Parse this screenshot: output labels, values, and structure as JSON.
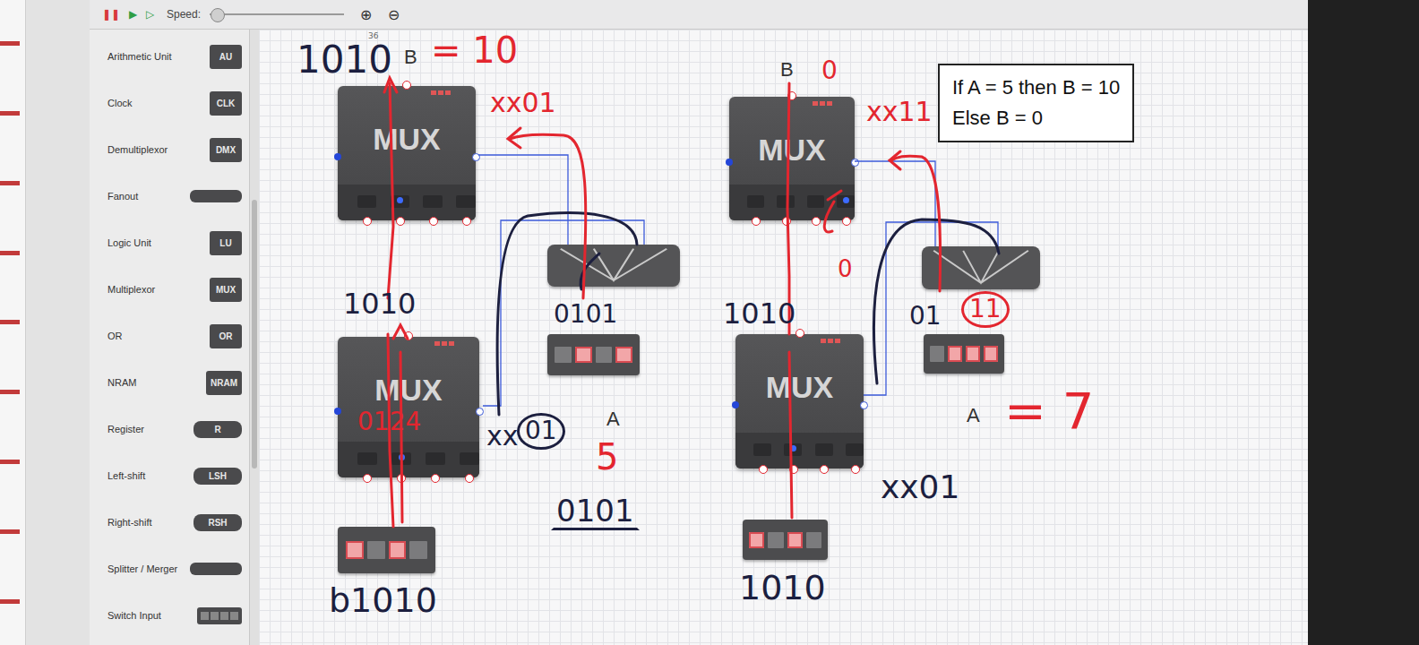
{
  "toolbar": {
    "controls": [
      {
        "glyph": "❚❚",
        "color": "#d83a3a"
      },
      {
        "glyph": "▶",
        "color": "#2f9e44"
      },
      {
        "glyph": "▷",
        "color": "#2f9e44"
      }
    ],
    "speed_label": "Speed:",
    "speed_level": 0.06,
    "zoom": [
      "⊕",
      "⊖"
    ]
  },
  "palette": [
    {
      "label": "Arithmetic Unit",
      "chip": "AU",
      "kind": "chip"
    },
    {
      "label": "Clock",
      "chip": "CLK",
      "kind": "chip"
    },
    {
      "label": "Demultiplexor",
      "chip": "DMX",
      "kind": "chip"
    },
    {
      "label": "Fanout",
      "chip": "",
      "kind": "bar"
    },
    {
      "label": "Logic Unit",
      "chip": "LU",
      "kind": "chip"
    },
    {
      "label": "Multiplexor",
      "chip": "MUX",
      "kind": "chip"
    },
    {
      "label": "OR",
      "chip": "OR",
      "kind": "chip"
    },
    {
      "label": "NRAM",
      "chip": "NRAM",
      "kind": "chip"
    },
    {
      "label": "Register",
      "chip": "R",
      "kind": "wide"
    },
    {
      "label": "Left-shift",
      "chip": "LSH",
      "kind": "wide"
    },
    {
      "label": "Right-shift",
      "chip": "RSH",
      "kind": "wide"
    },
    {
      "label": "Splitter / Merger",
      "chip": "",
      "kind": "bar"
    },
    {
      "label": "Switch Input",
      "chip": "",
      "kind": "switch"
    }
  ],
  "components": [
    {
      "kind": "mux",
      "label": "MUX",
      "selected_input": 1
    },
    {
      "kind": "mux",
      "label": "MUX",
      "selected_input": 1
    },
    {
      "kind": "mux",
      "label": "MUX",
      "selected_input": 3
    },
    {
      "kind": "mux",
      "label": "MUX",
      "selected_input": 1
    },
    {
      "kind": "splitter"
    },
    {
      "kind": "splitter"
    },
    {
      "kind": "switch",
      "bits": [
        true,
        false,
        true,
        false
      ]
    },
    {
      "kind": "switch",
      "bits": [
        false,
        true,
        false,
        true
      ]
    },
    {
      "kind": "switch",
      "bits": [
        true,
        false,
        true,
        false
      ]
    },
    {
      "kind": "switch",
      "bits": [
        false,
        true,
        true,
        true
      ]
    }
  ],
  "labels": [
    "B",
    "B",
    "A",
    "A"
  ],
  "note": [
    "If A = 5 then B = 10",
    "Else B = 0"
  ],
  "annotations": [
    {
      "text": "1010",
      "color": "#1c1f3f",
      "circled": false,
      "underlined": false
    },
    {
      "text": "36",
      "color": "#666666",
      "circled": false,
      "underlined": false
    },
    {
      "text": "= 10",
      "color": "#e3262f",
      "circled": false,
      "underlined": false
    },
    {
      "text": "xx01",
      "color": "#e3262f",
      "circled": false,
      "underlined": false
    },
    {
      "text": "1010",
      "color": "#1c1f3f",
      "circled": false,
      "underlined": false
    },
    {
      "text": "0124",
      "color": "#e3262f",
      "circled": false,
      "underlined": false
    },
    {
      "text": "xx",
      "color": "#1c1f3f",
      "circled": false,
      "underlined": false
    },
    {
      "text": "01",
      "color": "#1c1f3f",
      "circled": true,
      "underlined": false
    },
    {
      "text": "5",
      "color": "#e3262f",
      "circled": false,
      "underlined": false
    },
    {
      "text": "0101",
      "color": "#1c1f3f",
      "circled": false,
      "underlined": true
    },
    {
      "text": "b1010",
      "color": "#1c1f3f",
      "circled": false,
      "underlined": false
    },
    {
      "text": "0101",
      "color": "#1c1f3f",
      "circled": false,
      "underlined": false
    },
    {
      "text": "0",
      "color": "#e3262f",
      "circled": false,
      "underlined": false
    },
    {
      "text": "xx11",
      "color": "#e3262f",
      "circled": false,
      "underlined": false
    },
    {
      "text": "0",
      "color": "#e3262f",
      "circled": false,
      "underlined": false
    },
    {
      "text": "1010",
      "color": "#1c1f3f",
      "circled": false,
      "underlined": false
    },
    {
      "text": "01",
      "color": "#1c1f3f",
      "circled": false,
      "underlined": false
    },
    {
      "text": "11",
      "color": "#e3262f",
      "circled": true,
      "underlined": false
    },
    {
      "text": "= 7",
      "color": "#e3262f",
      "circled": false,
      "underlined": false
    },
    {
      "text": "xx01",
      "color": "#1c1f3f",
      "circled": false,
      "underlined": false
    },
    {
      "text": "1010",
      "color": "#1c1f3f",
      "circled": false,
      "underlined": false
    }
  ]
}
